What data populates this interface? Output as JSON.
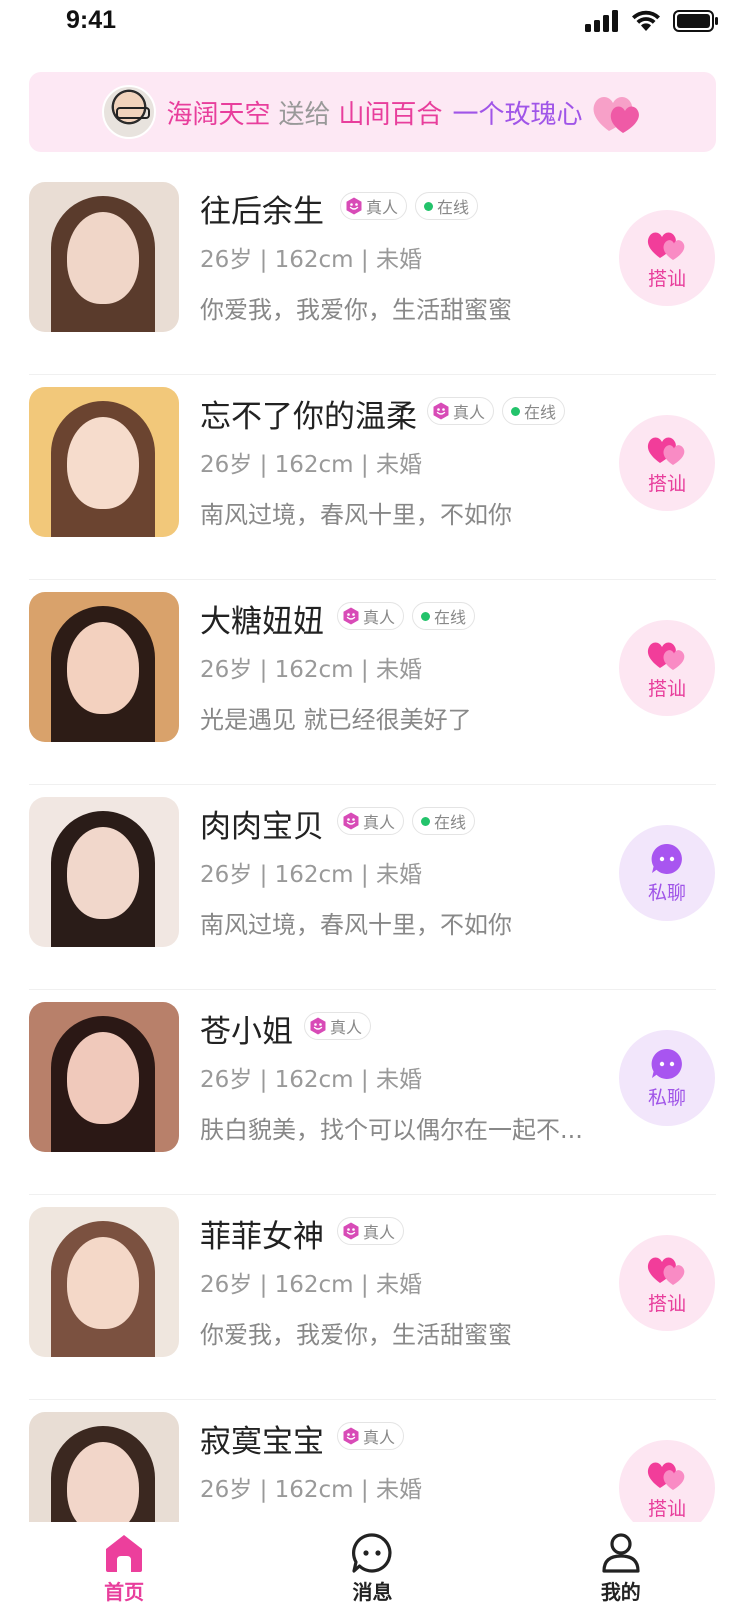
{
  "status_bar": {
    "time": "9:41"
  },
  "banner": {
    "sender": "海阔天空",
    "verb": "送给",
    "receiver": "山间百合",
    "gift": "一个玫瑰心"
  },
  "tags": {
    "verified": "真人",
    "online": "在线"
  },
  "actions": {
    "chat_up": "搭讪",
    "private_chat": "私聊"
  },
  "users": [
    {
      "name": "往后余生",
      "meta": "26岁 | 162cm | 未婚",
      "bio": "你爱我，我爱你，生活甜蜜蜜",
      "online": true,
      "action": "chat_up"
    },
    {
      "name": "忘不了你的温柔",
      "meta": "26岁 | 162cm | 未婚",
      "bio": "南风过境，春风十里，不如你",
      "online": true,
      "action": "chat_up"
    },
    {
      "name": "大糖妞妞",
      "meta": "26岁 | 162cm | 未婚",
      "bio": "光是遇见 就已经很美好了",
      "online": true,
      "action": "chat_up"
    },
    {
      "name": "肉肉宝贝",
      "meta": "26岁 | 162cm | 未婚",
      "bio": "南风过境，春风十里，不如你",
      "online": true,
      "action": "private_chat"
    },
    {
      "name": "苍小姐",
      "meta": "26岁 | 162cm | 未婚",
      "bio": "肤白貌美，找个可以偶尔在一起不...",
      "online": false,
      "action": "private_chat"
    },
    {
      "name": "菲菲女神",
      "meta": "26岁 | 162cm | 未婚",
      "bio": "你爱我，我爱你，生活甜蜜蜜",
      "online": false,
      "action": "chat_up"
    },
    {
      "name": "寂寞宝宝",
      "meta": "26岁 | 162cm | 未婚",
      "bio": "",
      "online": false,
      "action": "chat_up"
    }
  ],
  "tab_bar": {
    "home": "首页",
    "messages": "消息",
    "mine": "我的"
  },
  "colors": {
    "accent_pink": "#e83e9c",
    "accent_purple": "#a055e8",
    "online_green": "#23c36b"
  }
}
